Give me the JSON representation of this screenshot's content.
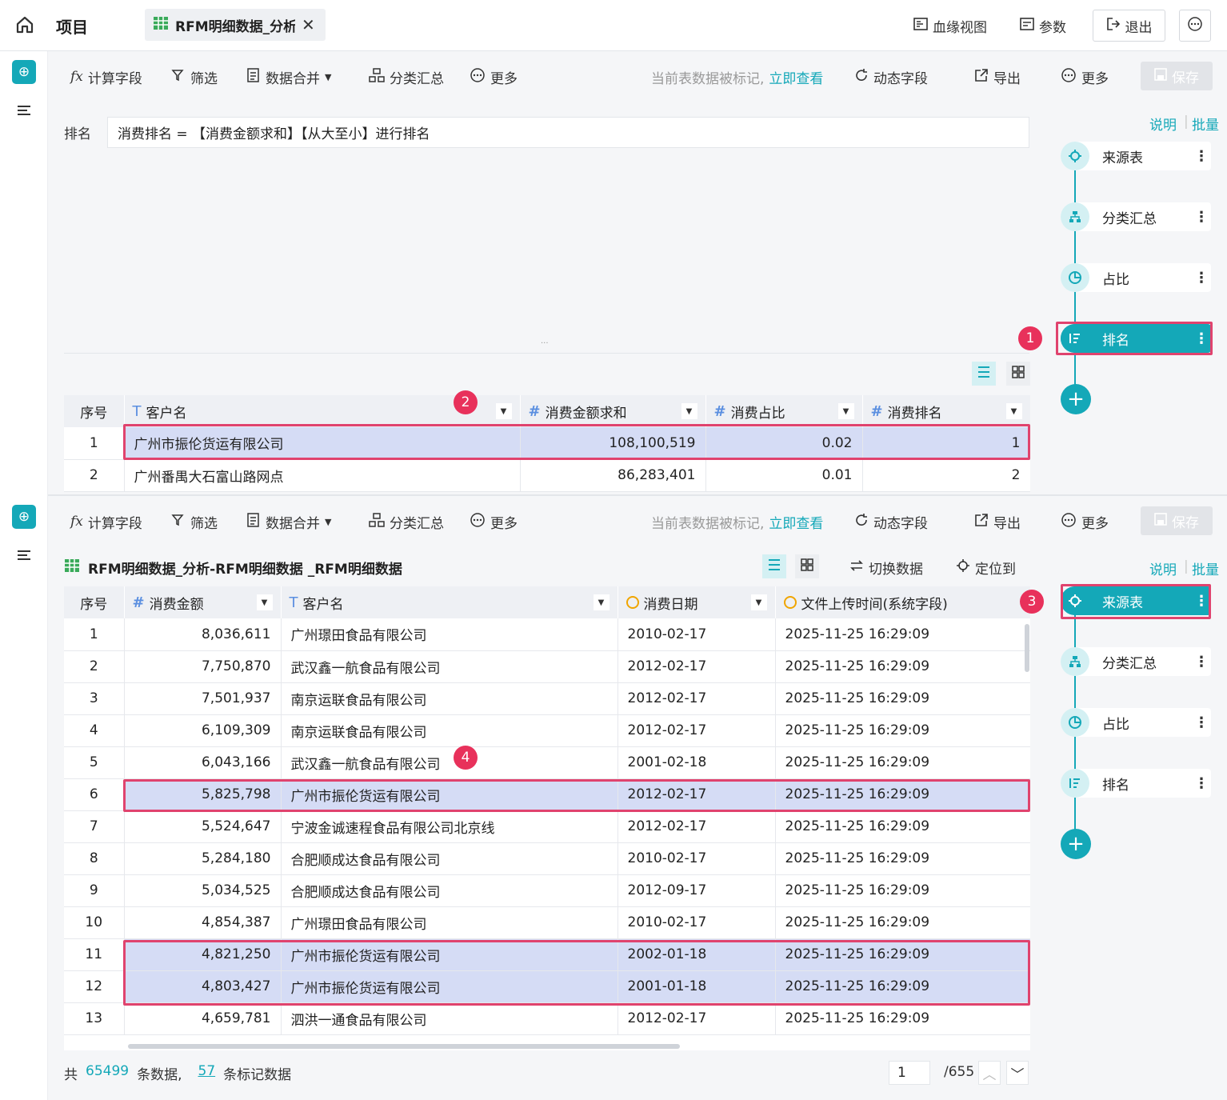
{
  "topbar": {
    "project_label": "项目",
    "tab_title": "RFM明细数据_分析",
    "lineage": "血缘视图",
    "params": "参数",
    "exit": "退出"
  },
  "toolbar": {
    "calc_field": "计算字段",
    "filter": "筛选",
    "merge": "数据合并",
    "group_sum": "分类汇总",
    "more": "更多",
    "marked_notice": "当前表数据被标记,",
    "view_now": "立即查看",
    "dynamic_field": "动态字段",
    "export": "导出",
    "more2": "更多",
    "save": "保存"
  },
  "pipeline": {
    "explain": "说明",
    "batch": "批量",
    "nodes": [
      "来源表",
      "分类汇总",
      "占比",
      "排名"
    ]
  },
  "top_panel": {
    "formula_label": "排名",
    "formula": "消费排名 = 【消费金额求和】【从大至小】进行排名",
    "splitter": "···",
    "columns": [
      "序号",
      "客户名",
      "消费金额求和",
      "消费占比",
      "消费排名"
    ],
    "rows": [
      [
        "1",
        "广州市振伦货运有限公司",
        "108,100,519",
        "0.02",
        "1"
      ],
      [
        "2",
        "广州番禺大石富山路网点",
        "86,283,401",
        "0.01",
        "2"
      ]
    ]
  },
  "bottom_panel": {
    "table_title": "RFM明细数据_分析-RFM明细数据 _RFM明细数据",
    "switch_data": "切换数据",
    "locate": "定位到",
    "columns": [
      "序号",
      "消费金额",
      "客户名",
      "消费日期",
      "文件上传时间(系统字段)"
    ],
    "rows": [
      [
        "1",
        "8,036,611",
        "广州璟田食品有限公司",
        "2010-02-17",
        "2025-11-25 16:29:09"
      ],
      [
        "2",
        "7,750,870",
        "武汉鑫一航食品有限公司",
        "2012-02-17",
        "2025-11-25 16:29:09"
      ],
      [
        "3",
        "7,501,937",
        "南京运联食品有限公司",
        "2012-02-17",
        "2025-11-25 16:29:09"
      ],
      [
        "4",
        "6,109,309",
        "南京运联食品有限公司",
        "2012-02-17",
        "2025-11-25 16:29:09"
      ],
      [
        "5",
        "6,043,166",
        "武汉鑫一航食品有限公司",
        "2001-02-18",
        "2025-11-25 16:29:09"
      ],
      [
        "6",
        "5,825,798",
        "广州市振伦货运有限公司",
        "2012-02-17",
        "2025-11-25 16:29:09"
      ],
      [
        "7",
        "5,524,647",
        "宁波金诚速程食品有限公司北京线",
        "2012-02-17",
        "2025-11-25 16:29:09"
      ],
      [
        "8",
        "5,284,180",
        "合肥顺成达食品有限公司",
        "2010-02-17",
        "2025-11-25 16:29:09"
      ],
      [
        "9",
        "5,034,525",
        "合肥顺成达食品有限公司",
        "2012-09-17",
        "2025-11-25 16:29:09"
      ],
      [
        "10",
        "4,854,387",
        "广州璟田食品有限公司",
        "2010-02-17",
        "2025-11-25 16:29:09"
      ],
      [
        "11",
        "4,821,250",
        "广州市振伦货运有限公司",
        "2002-01-18",
        "2025-11-25 16:29:09"
      ],
      [
        "12",
        "4,803,427",
        "广州市振伦货运有限公司",
        "2001-01-18",
        "2025-11-25 16:29:09"
      ],
      [
        "13",
        "4,659,781",
        "泗洪一通食品有限公司",
        "2012-02-17",
        "2025-11-25 16:29:09"
      ]
    ],
    "footer": {
      "total_prefix": "共",
      "total_count": "65499",
      "total_suffix": "条数据,",
      "marked_count": "57",
      "marked_suffix": "条标记数据",
      "page": "1",
      "pages": "/655"
    }
  },
  "badges": [
    "1",
    "2",
    "3",
    "4"
  ],
  "colors": {
    "accent": "#14a8b8",
    "highlight": "#d5dcf5",
    "annotation": "#e0436e"
  }
}
